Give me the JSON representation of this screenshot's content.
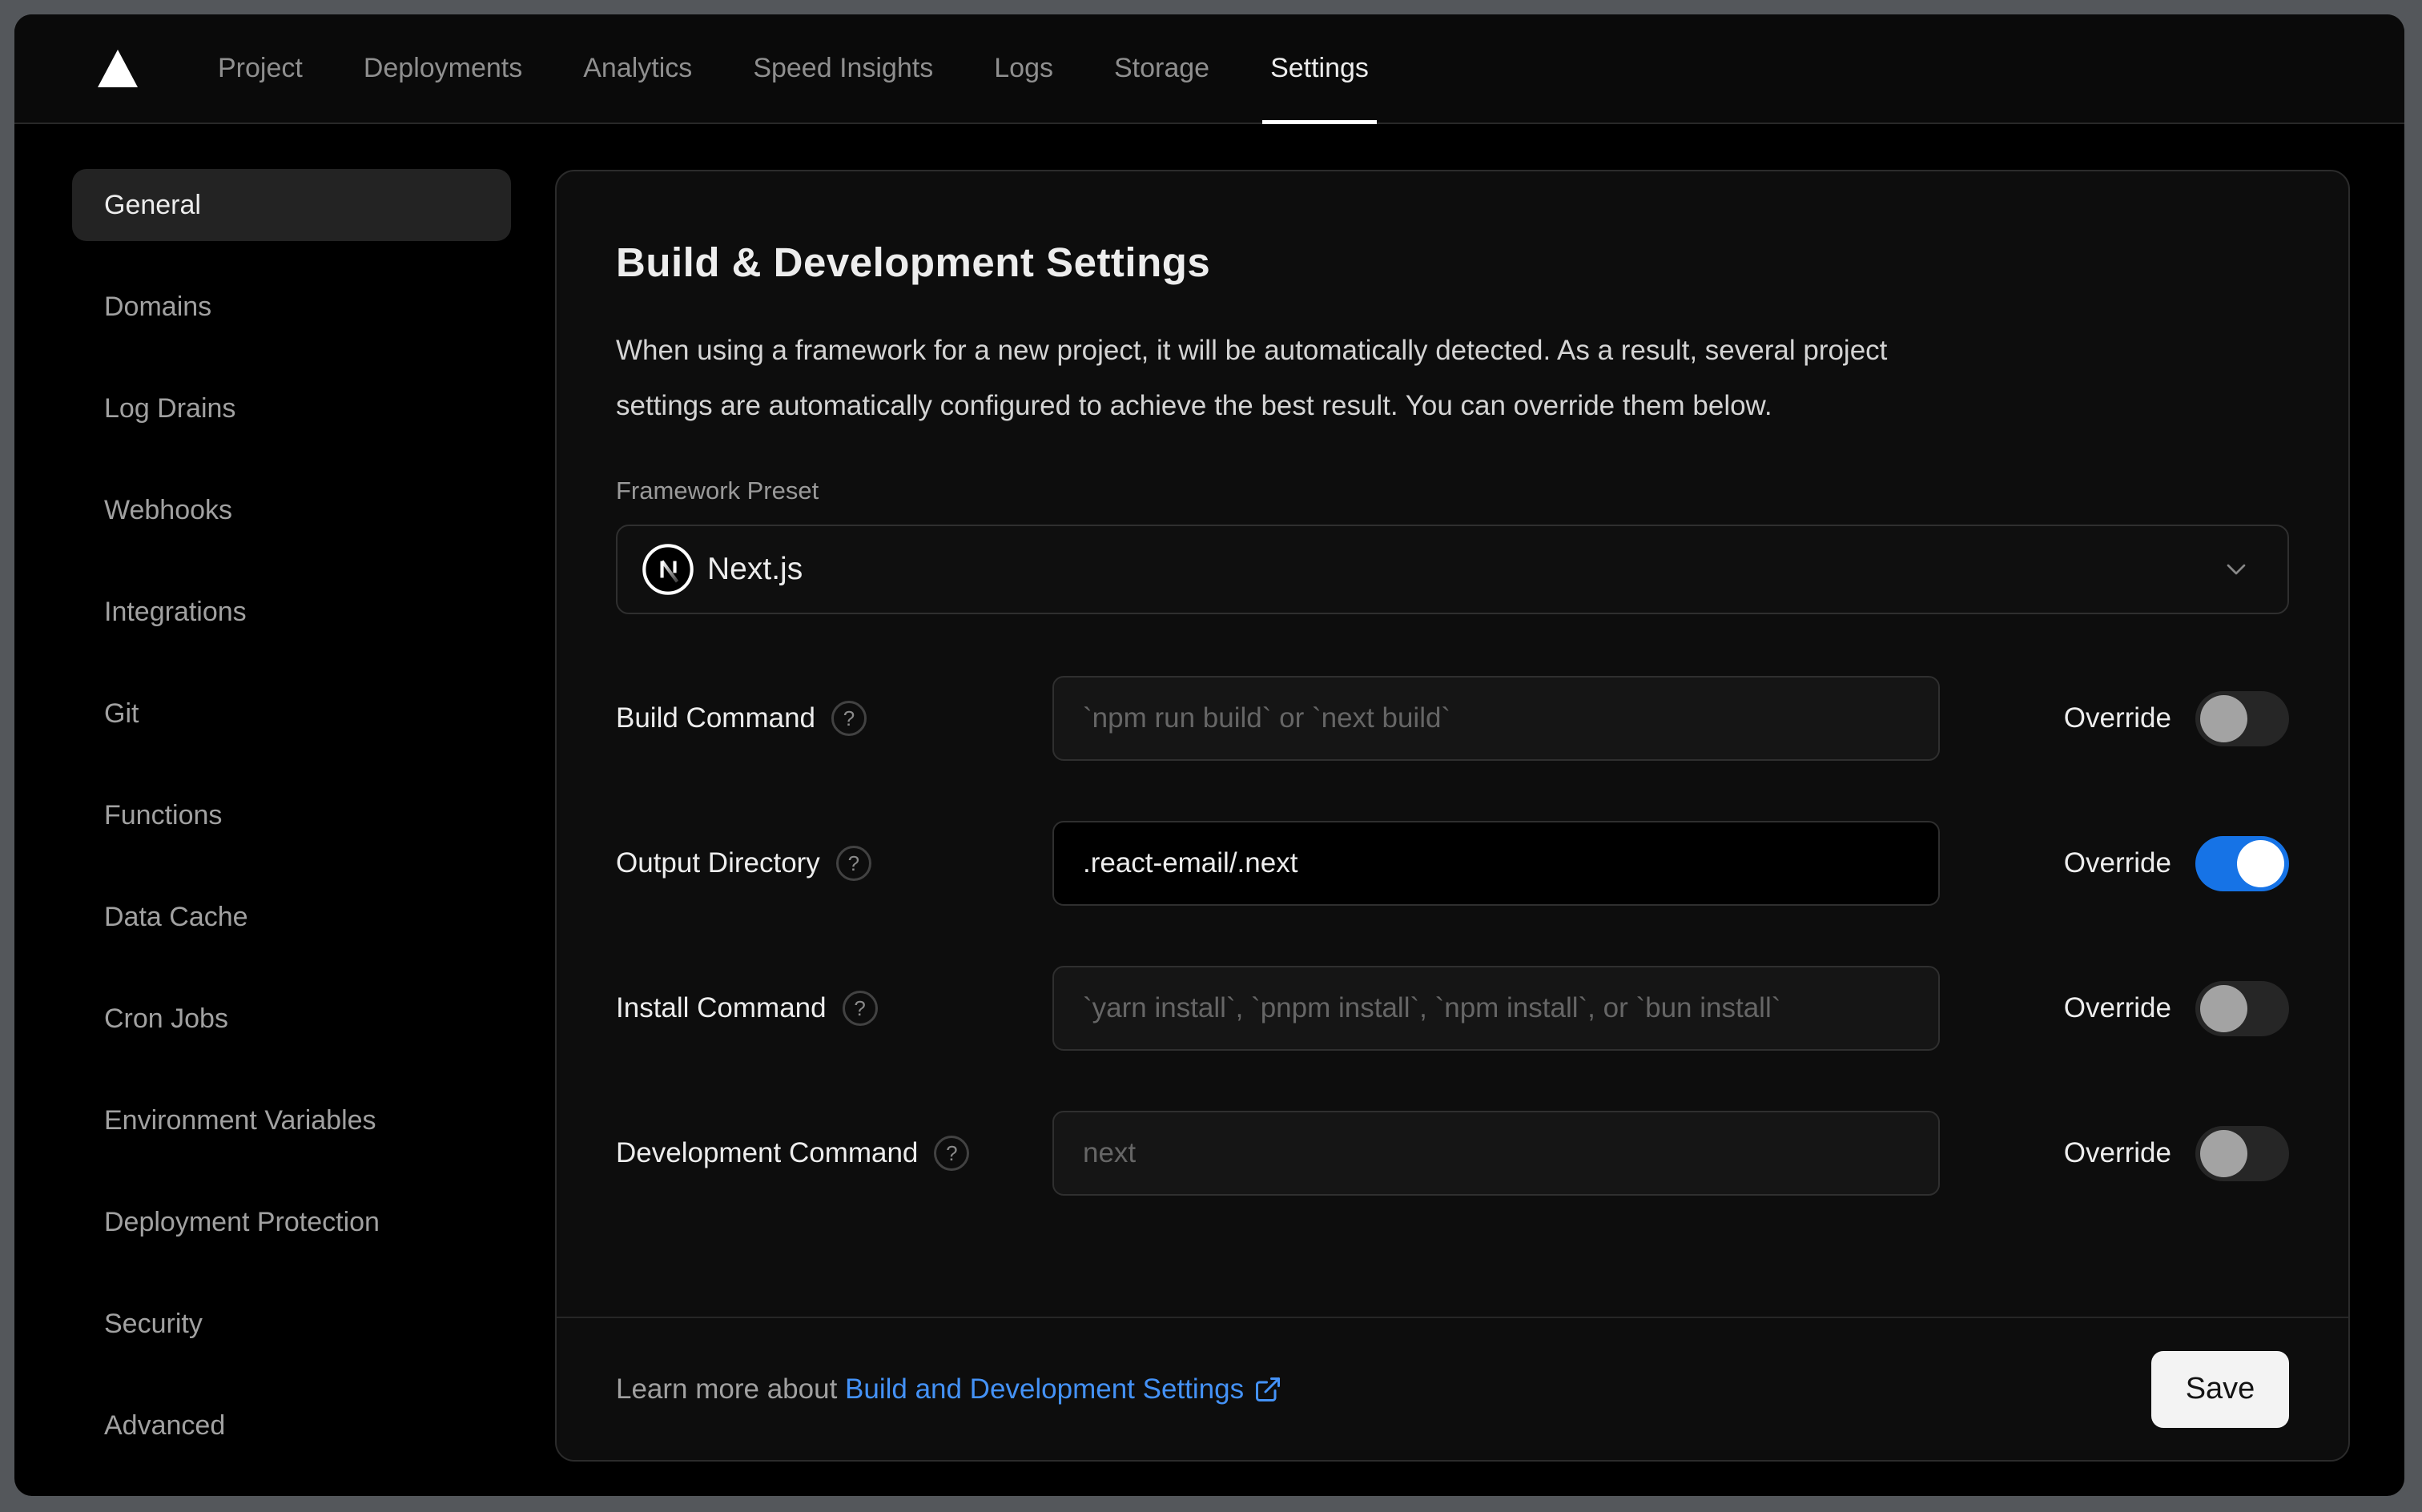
{
  "nav": {
    "items": [
      {
        "label": "Project",
        "active": false
      },
      {
        "label": "Deployments",
        "active": false
      },
      {
        "label": "Analytics",
        "active": false
      },
      {
        "label": "Speed Insights",
        "active": false
      },
      {
        "label": "Logs",
        "active": false
      },
      {
        "label": "Storage",
        "active": false
      },
      {
        "label": "Settings",
        "active": true
      }
    ]
  },
  "sidebar": {
    "items": [
      {
        "label": "General",
        "active": true
      },
      {
        "label": "Domains",
        "active": false
      },
      {
        "label": "Log Drains",
        "active": false
      },
      {
        "label": "Webhooks",
        "active": false
      },
      {
        "label": "Integrations",
        "active": false
      },
      {
        "label": "Git",
        "active": false
      },
      {
        "label": "Functions",
        "active": false
      },
      {
        "label": "Data Cache",
        "active": false
      },
      {
        "label": "Cron Jobs",
        "active": false
      },
      {
        "label": "Environment Variables",
        "active": false
      },
      {
        "label": "Deployment Protection",
        "active": false
      },
      {
        "label": "Security",
        "active": false
      },
      {
        "label": "Advanced",
        "active": false
      }
    ]
  },
  "main": {
    "title": "Build & Development Settings",
    "description_lines": [
      "When using a framework for a new project, it will be automatically detected. As a result, several project",
      "settings are automatically configured to achieve the best result. You can override them below."
    ],
    "framework_preset": {
      "label": "Framework Preset",
      "value": "Next.js"
    },
    "override_label": "Override",
    "fields": [
      {
        "label": "Build Command",
        "placeholder": "`npm run build` or `next build`",
        "value": "",
        "override": false
      },
      {
        "label": "Output Directory",
        "placeholder": "",
        "value": ".react-email/.next",
        "override": true
      },
      {
        "label": "Install Command",
        "placeholder": "`yarn install`, `pnpm install`, `npm install`, or `bun install`",
        "value": "",
        "override": false
      },
      {
        "label": "Development Command",
        "placeholder": "next",
        "value": "",
        "override": false
      }
    ],
    "footer": {
      "learn_more_prefix": "Learn more about ",
      "link_text": "Build and Development Settings",
      "save_label": "Save"
    }
  },
  "icons": {
    "help": "?"
  },
  "colors": {
    "toggle_on": "#1673e6",
    "link_blue": "#4492f7",
    "page_bg": "#000000",
    "card_bg": "#0d0d0d",
    "frame_gray": "#54575b",
    "active_item_bg": "#232323"
  }
}
